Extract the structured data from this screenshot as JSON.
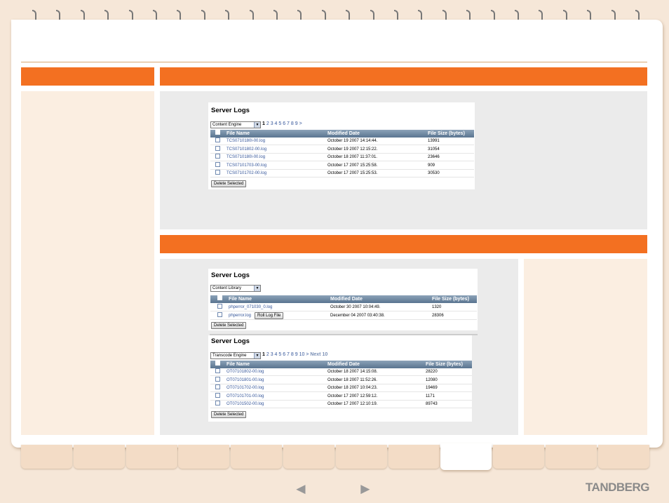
{
  "brand": {
    "logo": "TANDBERG"
  },
  "nav": {
    "prev": "◄",
    "next": "►"
  },
  "shot1": {
    "title": "Server Logs",
    "select_value": "Content Engine",
    "pages_current": "1",
    "pages_rest": "2 3 4 5 6 7 8 9 >",
    "columns": [
      "File Name",
      "Modified Date",
      "File Size (bytes)"
    ],
    "rows": [
      {
        "file": "TCS0710180l-00.log",
        "date": "October 19 2007 14:14:44.",
        "size": "13991"
      },
      {
        "file": "TCS07101802-00.log",
        "date": "October 19 2007 12:15:22.",
        "size": "31054"
      },
      {
        "file": "TCS0710180l-00.log",
        "date": "October 18 2007 11:37:01.",
        "size": "23646"
      },
      {
        "file": "TCS07101703-00.log",
        "date": "October 17 2007 15:25:58.",
        "size": "909"
      },
      {
        "file": "TCS07101702-00.log",
        "date": "October 17 2007 15:25:53.",
        "size": "30530"
      }
    ],
    "delete_label": "Delete Selected"
  },
  "shot2": {
    "title": "Server Logs",
    "select_value": "Content Library",
    "columns": [
      "File Name",
      "Modified Date",
      "File Size (bytes)"
    ],
    "rows": [
      {
        "file": "phperror_071030_0.log",
        "date": "October 30 2007 10:04:49.",
        "size": "1320"
      },
      {
        "file": "phperror.log",
        "date": "December 04 2007 03:40:38.",
        "size": "28306"
      }
    ],
    "roll_label": "Roll Log File",
    "delete_label": "Delete Selected"
  },
  "shot3": {
    "title": "Server Logs",
    "select_value": "Transcode Engine",
    "pages_current": "1",
    "pages_rest": "2 3 4 5 6 7 8 9 10 >",
    "next10": "Next 10",
    "columns": [
      "File Name",
      "Modified Date",
      "File Size (bytes)"
    ],
    "rows": [
      {
        "file": "OT07101802-00.log",
        "date": "October 18 2007 14:15:08.",
        "size": "28220"
      },
      {
        "file": "OT07101801-00.log",
        "date": "October 18 2007 11:52:26.",
        "size": "12080"
      },
      {
        "file": "OT07101702-00.log",
        "date": "October 18 2007 10:04:23.",
        "size": "19469"
      },
      {
        "file": "OT07101701-00.log",
        "date": "October 17 2007 12:59:12.",
        "size": "1171"
      },
      {
        "file": "OT07101502-00.log",
        "date": "October 17 2007 12:10:19.",
        "size": "89743"
      }
    ],
    "delete_label": "Delete Selected"
  }
}
